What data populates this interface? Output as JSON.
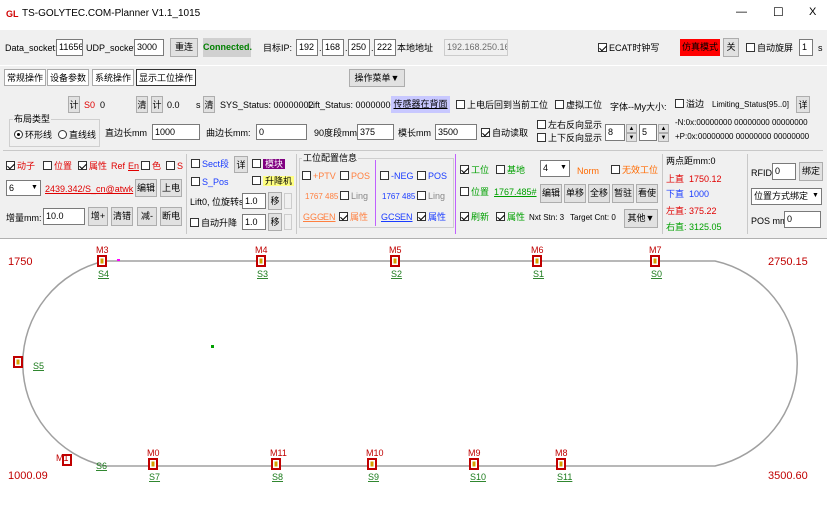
{
  "window": {
    "title": "TS-GOLYTEC.COM-Planner V1.1_1015",
    "logo": "GL",
    "minimize": "—",
    "maximize": "☐",
    "close": "X"
  },
  "conn": {
    "data_socket_label": "Data_socket:",
    "data_socket_value": "11656",
    "udp_socket_label": "UDP_socket:",
    "udp_socket_value": "3000",
    "reconnect": "重连",
    "status": "Connected.",
    "target_ip_label": "目标IP:",
    "ip": [
      "192",
      "168",
      "250",
      "222"
    ],
    "local_addr_label": "本地地址",
    "local_addr_value": "192.168.250.166",
    "ecat_label": "ECAT时钟写",
    "sim_mode": "仿真模式",
    "close_btn": "关",
    "auto_rotate_label": "自动旋屏",
    "rotate_value": "1",
    "rotate_unit": "s"
  },
  "tabs": [
    "常规操作",
    "设备参数",
    "系统操作",
    "显示工位操作"
  ],
  "op_menu": "操作菜单▼",
  "row1": {
    "ji1": "计",
    "s0_label": "S0",
    "s0_value": "0",
    "qing1": "清",
    "ji2": "计",
    "val2": "0.0",
    "s_unit": "s",
    "qing2": "清",
    "sys_status": "SYS_Status: 00000002",
    "lift_status": "Lift_Status: 00000000",
    "sensor_btn": "传感器在背面",
    "power_label": "上电后回到当前工位",
    "virtual_label": "虚拟工位",
    "font_size_label": "字体--My大小:",
    "overflow_label": "溢边",
    "limiting_status": "Limiting_Status[95..0]",
    "detail_btn": "详"
  },
  "layout_group": {
    "title": "布局类型",
    "ring": "环形线",
    "straight": "直线线",
    "straight_len_label": "直边长mm",
    "straight_len_value": "1000",
    "curve_len_label": "曲边长mm:",
    "curve_len_value": "0",
    "deg90_label": "90度段mm:",
    "deg90_value": "375",
    "module_label": "模长mm",
    "module_value": "3500",
    "auto_read": "自动读取",
    "lr_reverse": "左右反向显示",
    "ud_reverse": "上下反向显示",
    "font_value": "8",
    "font_value2": "5",
    "n_bits": "-N:0x:00000000  00000000  00000000",
    "p_bits": "+P:0x:00000000  00000000  00000000"
  },
  "row3": {
    "mover_label": "动子",
    "position_label": "位置",
    "attr_label": "属性",
    "ref_label": "Ref",
    "en_label": "En",
    "color_label": "色",
    "s_label": "S",
    "mover_sel": "6",
    "link_text": "2439.342/S_cn@atwk",
    "edit_btn": "编辑",
    "power_btn": "上电",
    "increment_label": "增量mm:",
    "increment_value": "10.0",
    "inc_btn": "增+",
    "clear_btn": "清错",
    "dec_btn": "减-",
    "off_btn": "断电",
    "section_label": "Sect段",
    "detail_btn": "详",
    "module_btn": "模块",
    "s_pos": "S_Pos",
    "lift_btn": "升降机",
    "lift_rev_label": "Lift0, 位旋转s:",
    "lift_rev_val": "1.0",
    "move_btn": "移",
    "auto_lift": "自动升降",
    "auto_lift_val": "1.0",
    "move_btn2": "移",
    "cfg_title": "工位配置信息",
    "ptv": "+PTV",
    "pos1": "POS",
    "neg": "-NEG",
    "pos2": "POS",
    "v1767a": "1767 485",
    "ling1": "Ling",
    "v1767b": "1767 485",
    "ling2": "Ling",
    "ggg": "GGG",
    "en1": "EN",
    "attr1": "属性",
    "gcs": "GCS",
    "en2": "EN",
    "attr2": "属性",
    "station": "工位",
    "base": "基地",
    "station_sel": "4",
    "norm": "Norm",
    "invalid_station": "无效工位",
    "pos_label": "位置",
    "pos_value": "1767.485#",
    "edit2": "编辑",
    "single": "单移",
    "all": "全移",
    "pause": "暂驻",
    "seq": "看使",
    "refresh": "刷新",
    "attr3": "属性",
    "nxt_stn": "Nxt Stn: 3",
    "target_cnt": "Target Cnt: 0",
    "other": "其他▼",
    "dist_title": "两点距mm:0",
    "upper_straight": "上直",
    "upper_val": "1750.12",
    "lower_straight": "下直",
    "lower_val": "1000",
    "left_straight": "左直:",
    "left_val": "375.22",
    "right_straight": "右直:",
    "right_val": "3125.05",
    "rfid_label": "RFID",
    "rfid_value": "0",
    "bind_btn": "绑定",
    "pos_bind": "位置方式绑定",
    "pos_mm_label": "POS mm",
    "pos_mm_value": "0"
  },
  "track": {
    "corner_tl": "1750",
    "corner_tr": "2750.15",
    "corner_bl": "1000.09",
    "corner_br": "3500.60",
    "top_markers": [
      {
        "m": "M3",
        "s": "S4"
      },
      {
        "m": "M4",
        "s": "S3"
      },
      {
        "m": "M5",
        "s": "S2"
      },
      {
        "m": "M6",
        "s": "S1"
      },
      {
        "m": "M7",
        "s": "S0"
      }
    ],
    "bottom_markers": [
      {
        "m": "M1",
        "s": "S6"
      },
      {
        "m": "M0",
        "s": "S7"
      },
      {
        "m": "M11",
        "s": "S8"
      },
      {
        "m": "M10",
        "s": "S9"
      },
      {
        "m": "M9",
        "s": "S10"
      },
      {
        "m": "M8",
        "s": "S11"
      }
    ],
    "left_marker": "S5",
    "colors": {
      "track": "#a0a0a0",
      "marker": "#c00000",
      "label": "#1a7a1a",
      "mlabel": "#c00000"
    }
  }
}
